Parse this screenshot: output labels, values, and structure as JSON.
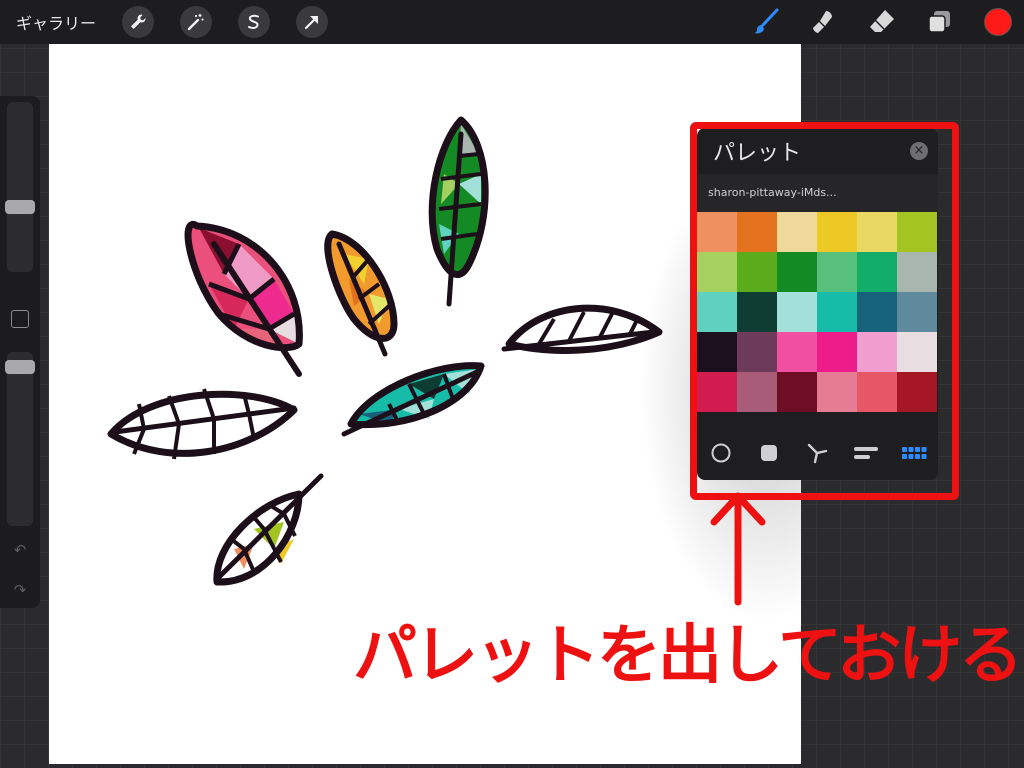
{
  "topbar": {
    "gallery_label": "ギャラリー",
    "actions": [
      {
        "name": "wrench-icon",
        "glyph": "✎"
      },
      {
        "name": "magic-wand-icon",
        "glyph": "✦"
      },
      {
        "name": "selection-icon",
        "glyph": "S"
      },
      {
        "name": "transform-arrow-icon",
        "glyph": "➚"
      }
    ],
    "right_tools": [
      "brush-icon",
      "smudge-icon",
      "eraser-icon",
      "layers-icon"
    ],
    "active_tool": "brush-icon",
    "current_color": "#ff1a1a"
  },
  "sidebar": {
    "brush_size_level": 0.25,
    "opacity_level": 0.05
  },
  "palette": {
    "title": "パレット",
    "close_icon": "close-icon",
    "name": "sharon-pittaway-iMds...",
    "swatches": [
      "#ef9060",
      "#e4711e",
      "#eed99a",
      "#edc925",
      "#e9d962",
      "#a3c421",
      "#a6d060",
      "#5aac1c",
      "#148a24",
      "#57c07a",
      "#13ad6a",
      "#a9b6b0",
      "#5fd2bf",
      "#0d3c33",
      "#a3e0d9",
      "#16bca7",
      "#16627a",
      "#5f8a9e",
      "#1b111e",
      "#6d3a5a",
      "#f050a2",
      "#ee1c8a",
      "#f19dcd",
      "#e8dde0",
      "#d21b4e",
      "#a95c78",
      "#6d0e24",
      "#e67c94",
      "#e65665",
      "#a51725"
    ],
    "modes": [
      "disc-mode-icon",
      "classic-mode-icon",
      "harmony-mode-icon",
      "value-mode-icon",
      "palettes-mode-icon"
    ],
    "active_mode": "palettes-mode-icon",
    "accent_color": "#2c8cff"
  },
  "annotation": {
    "text": "パレットを出しておける",
    "color": "#ee1111"
  }
}
